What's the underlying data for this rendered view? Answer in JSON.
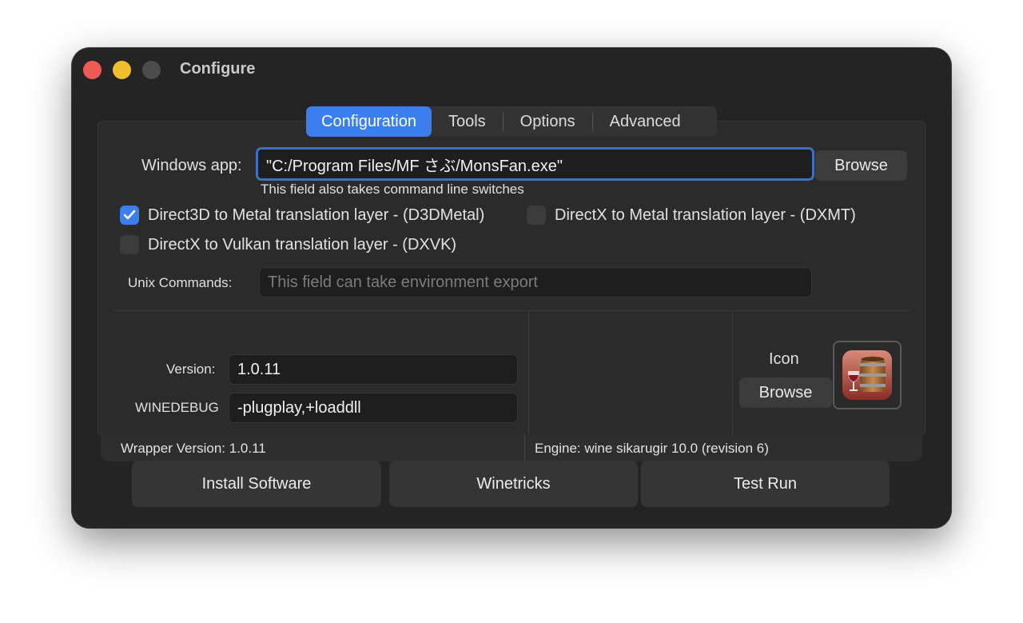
{
  "window": {
    "title": "Configure"
  },
  "tabs": [
    {
      "label": "Configuration",
      "active": true
    },
    {
      "label": "Tools",
      "active": false
    },
    {
      "label": "Options",
      "active": false
    },
    {
      "label": "Advanced",
      "active": false
    }
  ],
  "windows_app": {
    "label": "Windows app:",
    "value": "\"C:/Program Files/MF さぶ/MonsFan.exe\"",
    "hint": "This field also takes command line switches",
    "browse_label": "Browse"
  },
  "checkboxes": [
    {
      "label": "Direct3D to Metal translation layer - (D3DMetal)",
      "checked": true
    },
    {
      "label": "DirectX to Metal translation layer - (DXMT)",
      "checked": false
    },
    {
      "label": "DirectX to Vulkan translation layer - (DXVK)",
      "checked": false
    }
  ],
  "unix_commands": {
    "label": "Unix Commands:",
    "placeholder": "This field can take environment export",
    "value": ""
  },
  "version": {
    "label": "Version:",
    "value": "1.0.11"
  },
  "winedebug": {
    "label": "WINEDEBUG",
    "value": "-plugplay,+loaddll"
  },
  "icon_section": {
    "label": "Icon",
    "browse_label": "Browse",
    "icon": "wine-barrel-icon"
  },
  "status": {
    "wrapper": "Wrapper Version:  1.0.11",
    "engine": "Engine: wine sikarugir 10.0 (revision 6)"
  },
  "actions": {
    "install": "Install Software",
    "winetricks": "Winetricks",
    "test_run": "Test Run"
  },
  "colors": {
    "accent": "#3b7ef0",
    "close": "#ee5b55",
    "minimize": "#f0bd2e",
    "zoom": "#4d4c4d"
  }
}
